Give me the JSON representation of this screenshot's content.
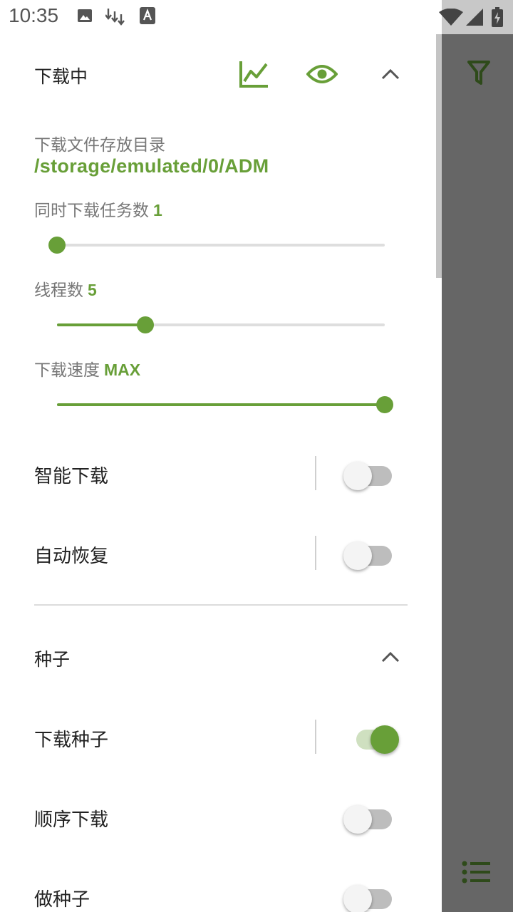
{
  "status_bar": {
    "time": "10:35"
  },
  "downloading_section": {
    "title": "下载中",
    "directory_label": "下载文件存放目录",
    "directory_path": "/storage/emulated/0/ADM",
    "concurrent_tasks": {
      "label": "同时下载任务数",
      "value": "1",
      "fraction": 0.0
    },
    "threads": {
      "label": "线程数",
      "value": "5",
      "fraction": 0.27
    },
    "speed": {
      "label": "下载速度",
      "value": "MAX",
      "fraction": 1.0
    },
    "smart_download": {
      "label": "智能下载",
      "enabled": false
    },
    "auto_resume": {
      "label": "自动恢复",
      "enabled": false
    }
  },
  "torrent_section": {
    "title": "种子",
    "download_torrents": {
      "label": "下载种子",
      "enabled": true
    },
    "sequential_download": {
      "label": "顺序下载",
      "enabled": false
    },
    "seeding": {
      "label": "做种子",
      "enabled": false
    }
  },
  "colors": {
    "accent": "#689f38",
    "scrim": "#666666",
    "filter_icon": "#2e4a1a"
  }
}
